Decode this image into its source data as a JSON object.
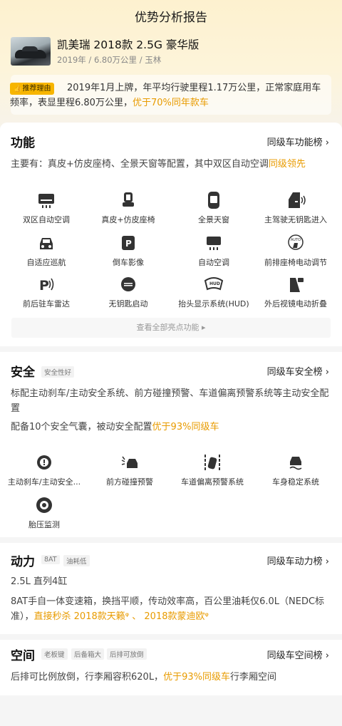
{
  "header": {
    "title": "优势分析报告"
  },
  "car": {
    "name": "凯美瑞 2018款 2.5G 豪华版",
    "meta": "2019年 / 6.80万公里 / 玉林"
  },
  "recommend": {
    "tag": "推荐理由",
    "text": "2019年1月上牌，年平均行驶里程1.17万公里，正常家庭用车频率，表显里程6.80万公里，",
    "highlight": "优于70%同年款车"
  },
  "function": {
    "title": "功能",
    "link": "同级车功能榜 ›",
    "desc": "主要有：真皮+仿皮座椅、全景天窗等配置，其中双区自动空调",
    "desc_highlight": "同级领先",
    "items": [
      {
        "label": "双区自动空调",
        "icon": "ac-dual-icon"
      },
      {
        "label": "真皮+仿皮座椅",
        "icon": "seat-icon"
      },
      {
        "label": "全景天窗",
        "icon": "sunroof-icon"
      },
      {
        "label": "主驾驶无钥匙进入",
        "icon": "keyless-door-icon"
      },
      {
        "label": "自适应巡航",
        "icon": "cruise-icon"
      },
      {
        "label": "倒车影像",
        "icon": "reverse-camera-icon"
      },
      {
        "label": "自动空调",
        "icon": "auto-ac-icon"
      },
      {
        "label": "前排座椅电动调节",
        "icon": "seat-adjust-icon"
      },
      {
        "label": "前后驻车雷达",
        "icon": "parking-radar-icon"
      },
      {
        "label": "无钥匙启动",
        "icon": "start-button-icon"
      },
      {
        "label": "抬头显示系统(HUD)",
        "icon": "hud-icon"
      },
      {
        "label": "外后视镜电动折叠",
        "icon": "mirror-fold-icon"
      }
    ],
    "more": "查看全部亮点功能 ▸"
  },
  "safety": {
    "title": "安全",
    "tag": "安全性好",
    "link": "同级车安全榜 ›",
    "desc1": "标配主动刹车/主动安全系统、前方碰撞预警、车道偏离预警系统等主动安全配置",
    "desc2": "配备10个安全气囊，被动安全配置",
    "desc2_highlight": "优于93%同级车",
    "items": [
      {
        "label": "主动刹车/主动安全...",
        "icon": "brake-icon"
      },
      {
        "label": "前方碰撞预警",
        "icon": "collision-warning-icon"
      },
      {
        "label": "车道偏离预警系统",
        "icon": "lane-departure-icon"
      },
      {
        "label": "车身稳定系统",
        "icon": "stability-icon"
      },
      {
        "label": "胎压监测",
        "icon": "tire-pressure-icon"
      }
    ]
  },
  "power": {
    "title": "动力",
    "tags": [
      "8AT",
      "油耗低"
    ],
    "link": "同级车动力榜 ›",
    "engine": "2.5L 直列4缸",
    "desc": "8AT手自一体变速箱，换挡平顺，传动效率高，百公里油耗仅6.0L（NEDC标准），",
    "desc_hl": "直接秒杀 2018款天籁",
    "sep": " 、 ",
    "desc_hl2": "2018款蒙迪欧"
  },
  "space": {
    "title": "空间",
    "tags": [
      "老板键",
      "后备箱大",
      "后排可放倒"
    ],
    "link": "同级车空间榜 ›",
    "desc": "后排可比例放倒，行李厢容积620L，",
    "desc_highlight": "优于93%同级车",
    "desc_tail": "行李厢空间"
  },
  "colors": {
    "accent": "#e89b00",
    "tag_yellow": "#f7b500"
  }
}
